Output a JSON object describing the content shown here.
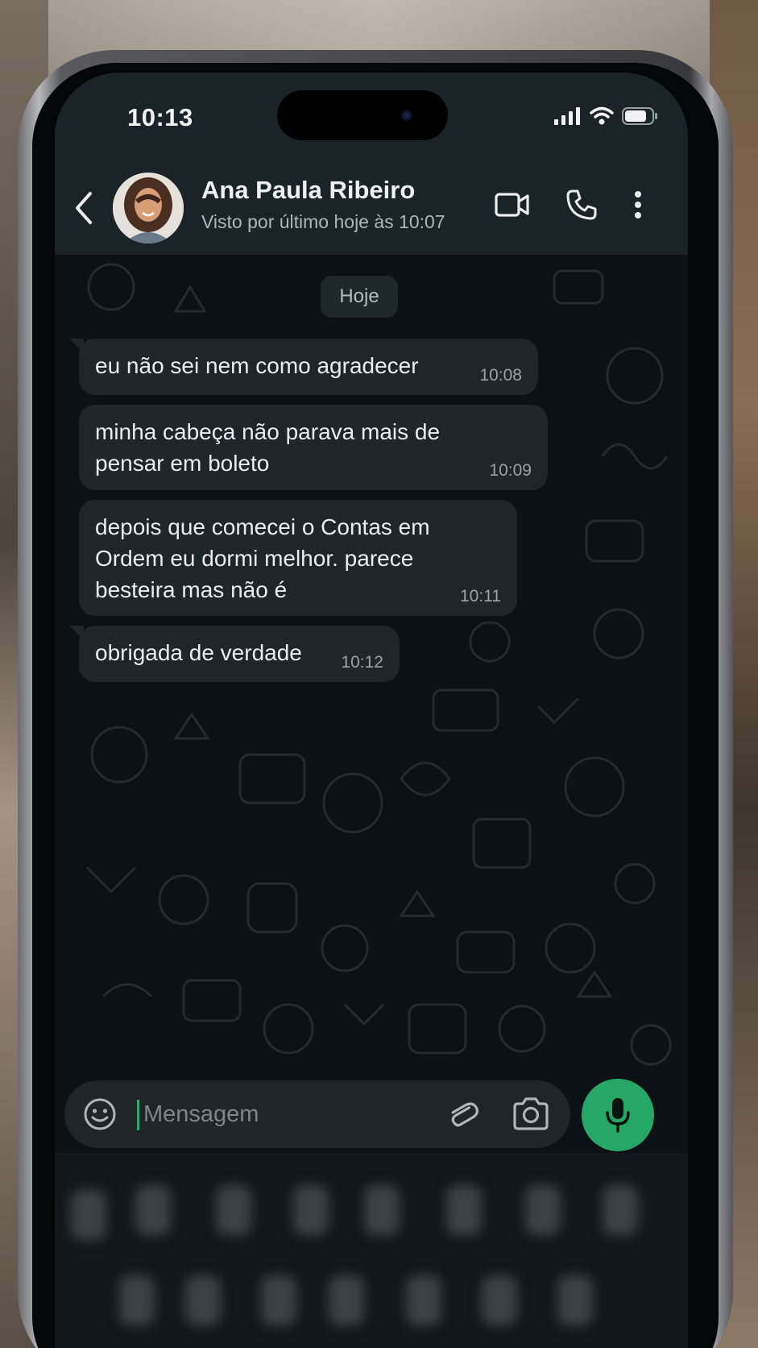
{
  "status_bar": {
    "time": "10:13",
    "icons": [
      "signal-icon",
      "wifi-icon",
      "battery-icon"
    ]
  },
  "header": {
    "contact_name": "Ana Paula Ribeiro",
    "last_seen": "Visto por último hoje às 10:07",
    "icons": [
      "back-icon",
      "video-call-icon",
      "phone-icon",
      "more-vertical-icon"
    ]
  },
  "chat": {
    "date_chip": "Hoje",
    "messages": [
      {
        "text": "eu não sei nem como agradecer",
        "time": "10:08"
      },
      {
        "text": "minha cabeça não parava mais de\npensar em boleto",
        "time": "10:09"
      },
      {
        "text": "depois que comecei o Contas em\nOrdem eu dormi melhor. parece\nbesteira mas não é",
        "time": "10:11"
      },
      {
        "text": "obrigada de verdade",
        "time": "10:12"
      }
    ]
  },
  "composer": {
    "placeholder": "Mensagem",
    "icons": [
      "emoji-icon",
      "attach-icon",
      "camera-icon",
      "mic-icon"
    ]
  },
  "colors": {
    "accent": "#25a865",
    "header_bg": "#1a2327",
    "chat_bg": "#0b1114",
    "bubble_bg": "#1f2629"
  }
}
